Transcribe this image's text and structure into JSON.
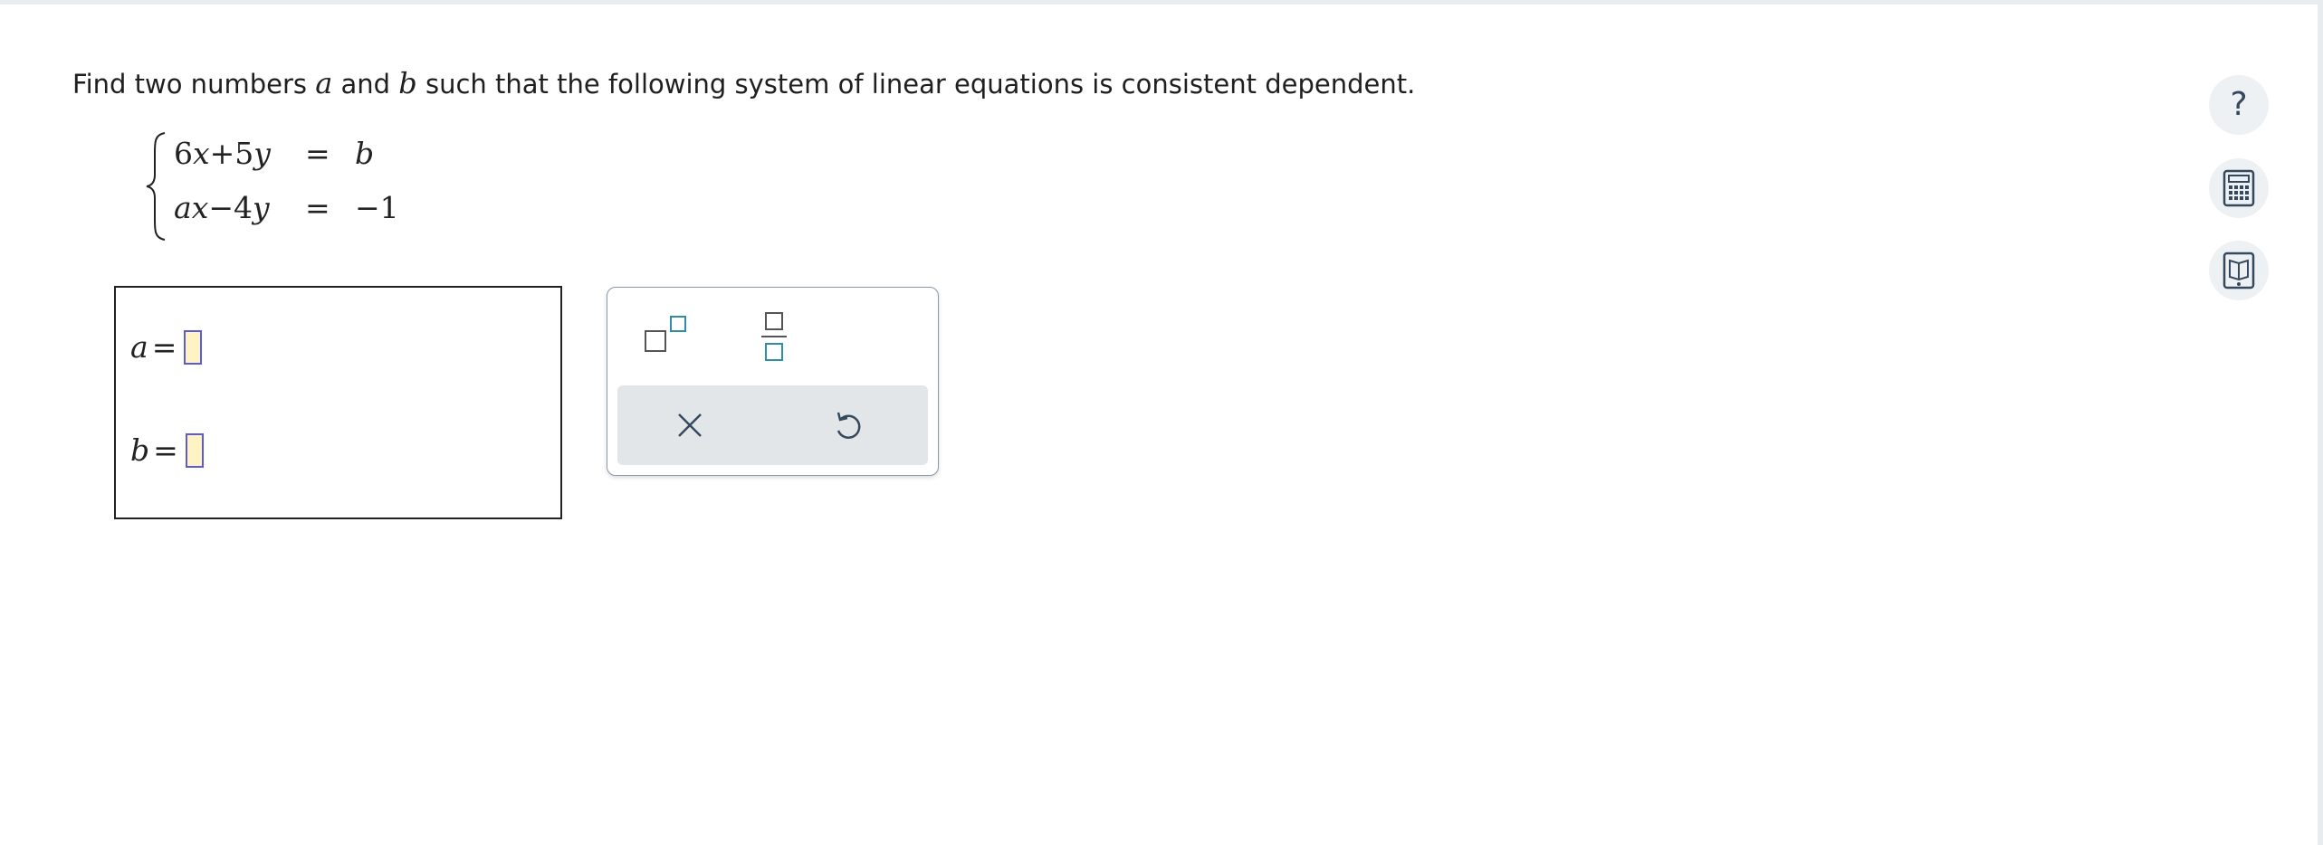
{
  "question": {
    "prefix": "Find two numbers ",
    "var_a": "a",
    "mid": " and ",
    "var_b": "b",
    "suffix": " such that the following system of linear equations is consistent dependent."
  },
  "system": {
    "row1": {
      "lhs_coef1": "6",
      "lhs_var1": "x",
      "lhs_op": "+",
      "lhs_coef2": "5",
      "lhs_var2": "y",
      "rel": "=",
      "rhs": "b"
    },
    "row2": {
      "lhs_coef1": "a",
      "lhs_var1": "x",
      "lhs_op": "−",
      "lhs_coef2": "4",
      "lhs_var2": "y",
      "rel": "=",
      "rhs": "−1"
    }
  },
  "answers": {
    "a_label": "a",
    "a_equals": "=",
    "a_value": "",
    "b_label": "b",
    "b_equals": "=",
    "b_value": ""
  },
  "palette": {
    "buttons": [
      "superscript-icon",
      "fraction-icon",
      "clear-icon",
      "undo-icon"
    ]
  },
  "sidebar": {
    "help_symbol": "?",
    "icons": [
      "help-icon",
      "calculator-icon",
      "ebook-icon"
    ]
  },
  "colors": {
    "accent_teal": "#2e8fa3",
    "slot_fill": "#fff3c4",
    "slot_border": "#5b5bd6",
    "icon_dark": "#34495e"
  }
}
